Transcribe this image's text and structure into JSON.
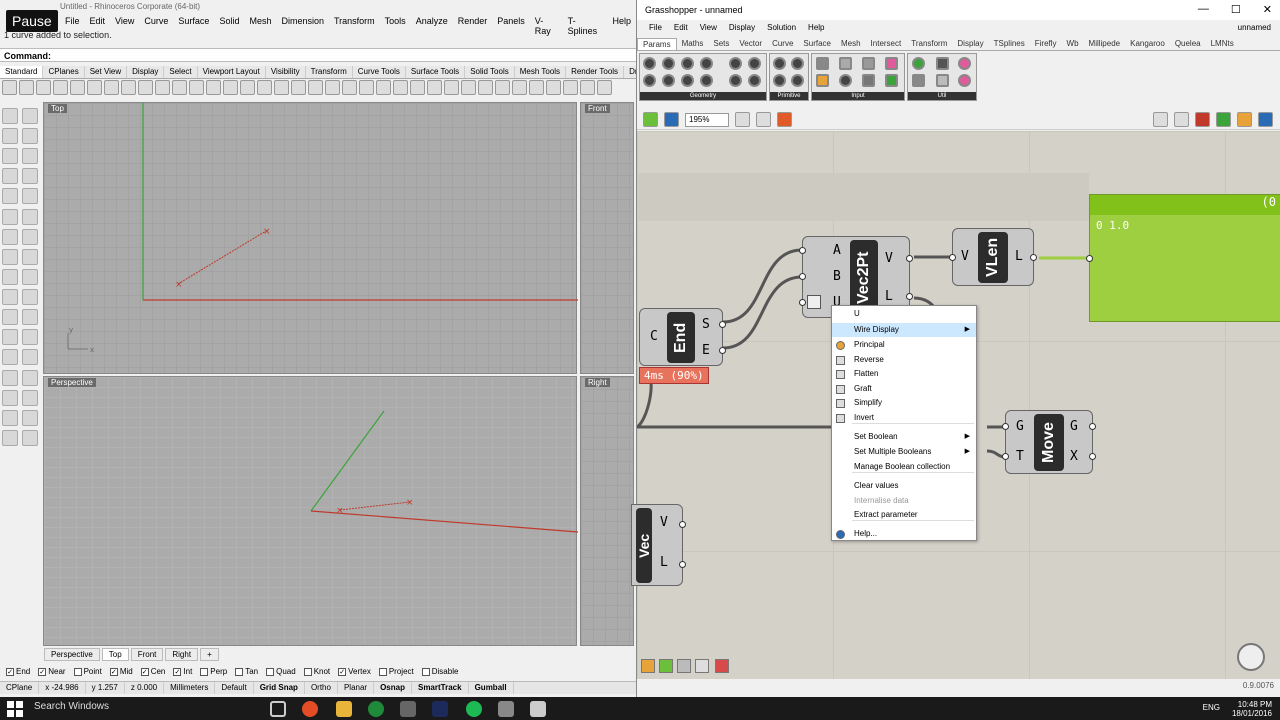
{
  "rhino": {
    "title": "Untitled - Rhinoceros Corporate (64-bit)",
    "menu": [
      "File",
      "Edit",
      "View",
      "Curve",
      "Surface",
      "Solid",
      "Mesh",
      "Dimension",
      "Transform",
      "Tools",
      "Analyze",
      "Render",
      "Panels",
      "V-Ray",
      "T-Splines",
      "Help"
    ],
    "history": "1 curve added to selection.",
    "command_label": "Command:",
    "toolbar_tabs": [
      "Standard",
      "CPlanes",
      "Set View",
      "Display",
      "Select",
      "Viewport Layout",
      "Visibility",
      "Transform",
      "Curve Tools",
      "Surface Tools",
      "Solid Tools",
      "Mesh Tools",
      "Render Tools",
      "Drafting"
    ],
    "viewports": {
      "top": "Top",
      "front": "Front",
      "perspective": "Perspective",
      "right": "Right"
    },
    "viewport_tabs": [
      "Perspective",
      "Top",
      "Front",
      "Right",
      "+"
    ],
    "osnaps": [
      {
        "label": "End",
        "checked": true
      },
      {
        "label": "Near",
        "checked": true
      },
      {
        "label": "Point",
        "checked": false
      },
      {
        "label": "Mid",
        "checked": true
      },
      {
        "label": "Cen",
        "checked": true
      },
      {
        "label": "Int",
        "checked": true
      },
      {
        "label": "Perp",
        "checked": false
      },
      {
        "label": "Tan",
        "checked": false
      },
      {
        "label": "Quad",
        "checked": false
      },
      {
        "label": "Knot",
        "checked": false
      },
      {
        "label": "Vertex",
        "checked": true
      },
      {
        "label": "Project",
        "checked": false
      },
      {
        "label": "Disable",
        "checked": false
      }
    ],
    "status": {
      "cplane": "CPlane",
      "x": "x -24.986",
      "y": "y 1.257",
      "z": "z 0.000",
      "units": "Millimeters",
      "layer": "Default",
      "grid_snap": "Grid Snap",
      "ortho": "Ortho",
      "planar": "Planar",
      "osnap": "Osnap",
      "smarttrack": "SmartTrack",
      "gumball": "Gumball"
    }
  },
  "pause_label": "Pause",
  "grasshopper": {
    "title": "Grasshopper - unnamed",
    "doc_name": "unnamed",
    "menu": [
      "File",
      "Edit",
      "View",
      "Display",
      "Solution",
      "Help"
    ],
    "tabs": [
      "Params",
      "Maths",
      "Sets",
      "Vector",
      "Curve",
      "Surface",
      "Mesh",
      "Intersect",
      "Transform",
      "Display",
      "TSplines",
      "Firefly",
      "Wb",
      "Millipede",
      "Kangaroo",
      "Quelea",
      "LMNts"
    ],
    "ribbon_groups": [
      "Geometry",
      "Primitive",
      "Input",
      "Util"
    ],
    "zoom": "195%",
    "components": {
      "vec2pt": {
        "name": "Vec2Pt",
        "inputs": [
          "A",
          "B",
          "U"
        ],
        "outputs": [
          "V",
          "L"
        ]
      },
      "vlen": {
        "name": "VLen",
        "inputs": [
          "V"
        ],
        "outputs": [
          "L"
        ]
      },
      "end": {
        "name": "End",
        "inputs": [
          "C"
        ],
        "outputs": [
          "S",
          "E"
        ]
      },
      "move": {
        "name": "Move",
        "inputs": [
          "G",
          "T"
        ],
        "outputs": [
          "G",
          "X"
        ]
      },
      "vec": {
        "name": "Vec",
        "outputs": [
          "V",
          "L"
        ]
      }
    },
    "panel": {
      "header": "(0",
      "row": "0 1.0"
    },
    "timing": "4ms (90%)",
    "context_menu": {
      "header": "U",
      "items": [
        {
          "label": "Wire Display",
          "submenu": true
        },
        {
          "label": "Principal"
        },
        {
          "label": "Reverse"
        },
        {
          "label": "Flatten"
        },
        {
          "label": "Graft"
        },
        {
          "label": "Simplify"
        },
        {
          "label": "Invert"
        },
        {
          "label": "Set Boolean",
          "submenu": true
        },
        {
          "label": "Set Multiple Booleans",
          "submenu": true
        },
        {
          "label": "Manage Boolean collection"
        },
        {
          "label": "Clear values"
        },
        {
          "label": "Internalise data",
          "disabled": true
        },
        {
          "label": "Extract parameter"
        },
        {
          "label": "Help..."
        }
      ]
    },
    "version": "0.9.0076"
  },
  "taskbar": {
    "search": "Search Windows",
    "lang": "ENG",
    "time": "10:48 PM",
    "date": "18/01/2016"
  },
  "colors": {
    "panel_green": "#9ecf40",
    "timing_red": "#e8735d",
    "axis_x": "#c0392b",
    "axis_y": "#3aa33a"
  }
}
